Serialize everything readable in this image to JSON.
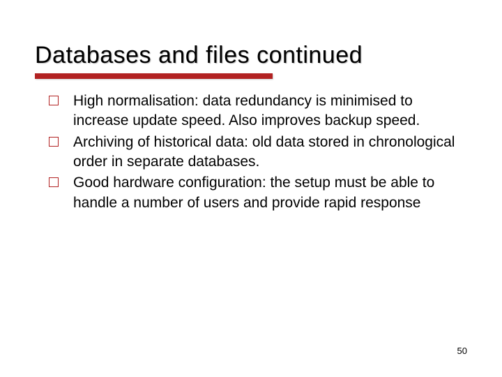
{
  "title": "Databases and files continued",
  "bullets": [
    {
      "text": "High normalisation: data redundancy is minimised to increase update speed. Also improves backup speed."
    },
    {
      "text": "Archiving of historical data: old data stored in chronological order in separate databases."
    },
    {
      "text": "Good hardware configuration: the setup must be able to handle a number of users and provide rapid response"
    }
  ],
  "pageNumber": "50"
}
